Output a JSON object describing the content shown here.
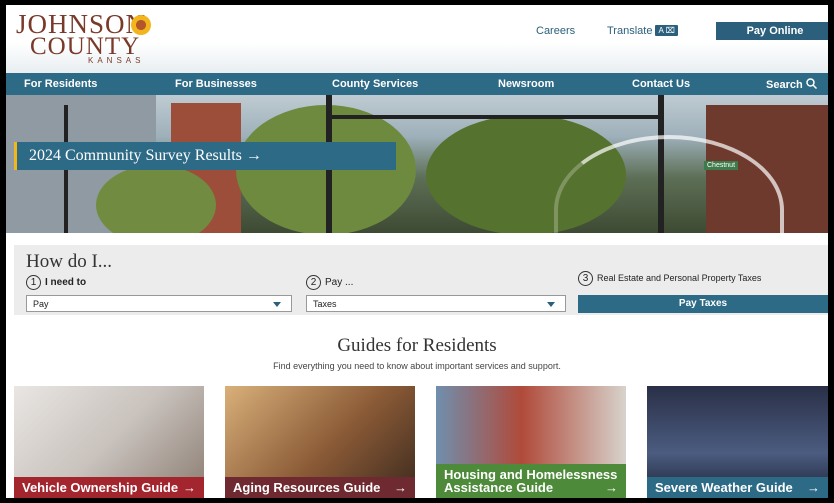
{
  "header": {
    "logo": {
      "line1": "JOHNSON",
      "line2": "COUNTY",
      "line3": "KANSAS"
    },
    "links": {
      "careers": "Careers",
      "translate": "Translate",
      "translate_badge": "A ⌧",
      "pay_online": "Pay Online"
    }
  },
  "nav": {
    "items": [
      "For Residents",
      "For Businesses",
      "County Services",
      "Newsroom",
      "Contact Us"
    ],
    "search": "Search"
  },
  "hero": {
    "banner": "2024 Community Survey Results →",
    "street_sign": "Chestnut"
  },
  "how": {
    "title": "How do I...",
    "step1": {
      "number": "1",
      "label": "I need to",
      "value": "Pay"
    },
    "step2": {
      "number": "2",
      "label": "Pay ...",
      "value": "Taxes"
    },
    "step3": {
      "number": "3",
      "label": "Real Estate and Personal Property Taxes",
      "button": "Pay Taxes"
    }
  },
  "guides": {
    "title": "Guides for Residents",
    "subtitle": "Find everything you need to know about important services and support.",
    "cards": [
      {
        "label": "Vehicle Ownership Guide",
        "color": "#a3262f"
      },
      {
        "label": "Aging Resources Guide",
        "color": "#6e2a30"
      },
      {
        "label": "Housing and Homelessness Assistance Guide",
        "color": "#4d8a3a"
      },
      {
        "label": "Severe Weather Guide",
        "color": "#2d6a86"
      }
    ]
  },
  "colors": {
    "brand_blue": "#2d6a86",
    "accent_gold": "#f2b51c",
    "logo_brown": "#7a3a2a"
  }
}
